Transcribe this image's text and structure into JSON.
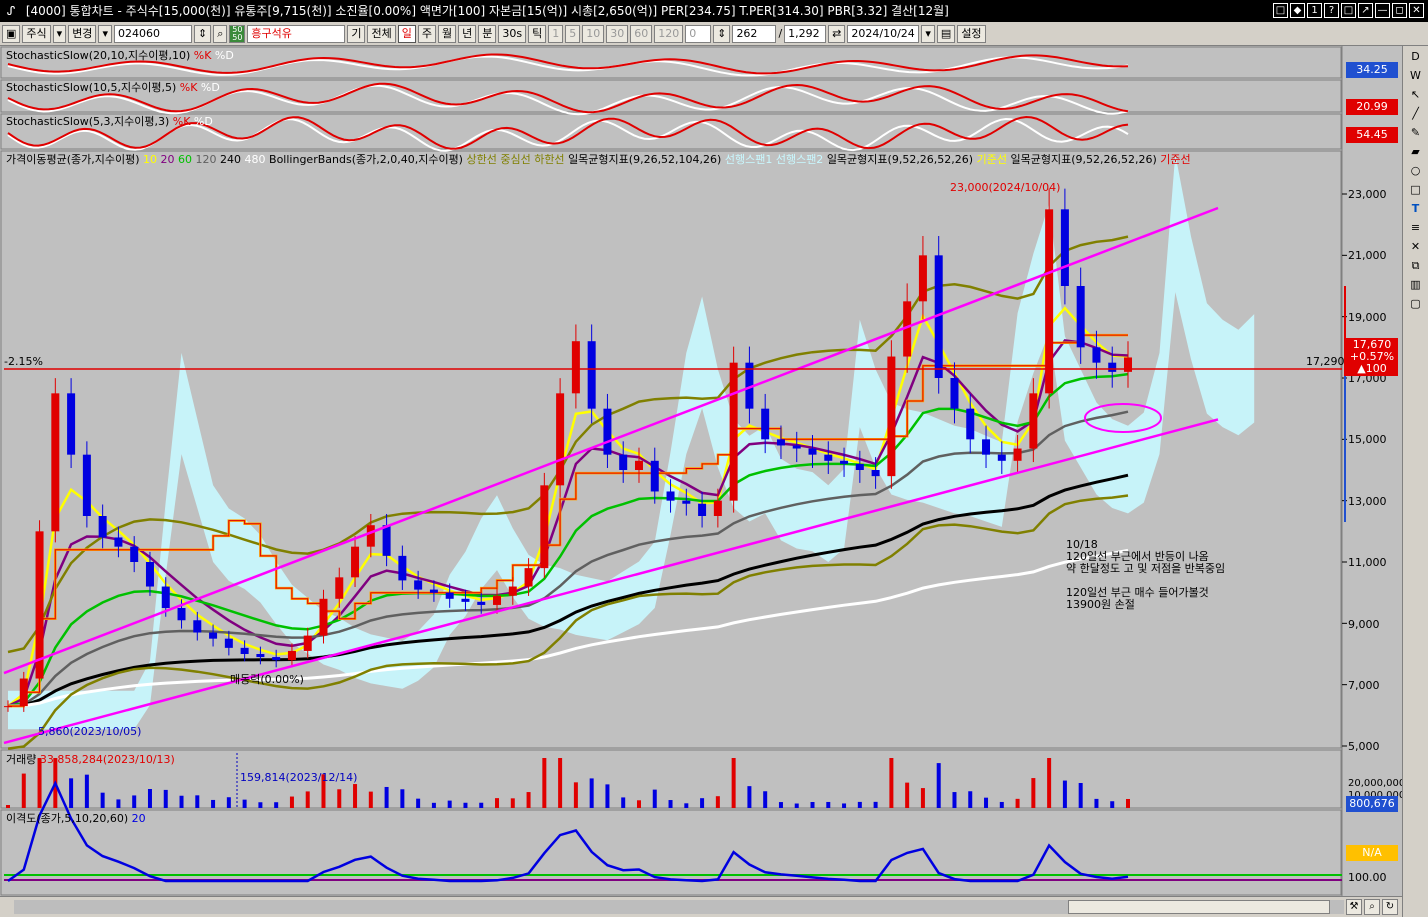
{
  "window": {
    "title": "[4000] 통합차트 - 주식수[15,000(천)] 유통주[9,715(천)] 소진율[0.00%] 액면가[100] 자본금[15(억)] 시총[2,650(억)] PER[234.75] T.PER[314.30] PBR[3.32] 결산[12월]",
    "buttons": [
      "□",
      "◆",
      "1",
      "?",
      "□",
      "↗",
      "—",
      "◻",
      "✕"
    ]
  },
  "toolbar": {
    "market": "주식",
    "change": "변경",
    "code": "024060",
    "name": "흥구석유",
    "btn_gi": "기",
    "btn_all": "전체",
    "periods": [
      "일",
      "주",
      "월",
      "년",
      "분",
      "30s",
      "틱"
    ],
    "minutes": [
      "1",
      "5",
      "10",
      "30",
      "60",
      "120"
    ],
    "spin_value": "0",
    "count": "262",
    "total": "1,292",
    "date": "2024/10/24",
    "settings": "설정",
    "green_top": "50",
    "green_bottom": "50"
  },
  "panels": {
    "stoch1": {
      "name": "StochasticSlow(20,10,지수이평,10)",
      "k": "%K",
      "d": "%D",
      "value": "34.25"
    },
    "stoch2": {
      "name": "StochasticSlow(10,5,지수이평,5)",
      "k": "%K",
      "d": "%D",
      "value": "20.99"
    },
    "stoch3": {
      "name": "StochasticSlow(5,3,지수이평,3)",
      "k": "%K",
      "d": "%D",
      "value": "54.45"
    },
    "main_legend": {
      "ma": "가격이동평균(종가,지수이평)",
      "ma_periods": [
        "10",
        "20",
        "60",
        "120",
        "240",
        "480"
      ],
      "ma_colors": [
        "#ffff00",
        "#800080",
        "#00c000",
        "#606060",
        "#000000",
        "#ffffff"
      ],
      "bb": "BollingerBands(종가,2,0,40,지수이평)",
      "bb_bands": "상한선 중심선 하한선",
      "ich1": "일목균형지표(9,26,52,104,26)",
      "ich1_span1": "선행스팬1",
      "ich1_span2": "선행스팬2",
      "ich2": "일목균형지표(9,52,26,52,26)",
      "ich2_base": "기준선",
      "ich3": "일목균형지표(9,52,26,52,26)",
      "ich3_base": "기준선"
    },
    "volume": {
      "name": "거래량",
      "max_label": "33,858,284(2023/10/13)",
      "min_label": "159,814(2023/12/14)",
      "value": "800,676"
    },
    "disparity": {
      "name": "이격도(종가,5,10,20,60)",
      "period": "20",
      "value": "N/A",
      "axis": "100.00"
    }
  },
  "price": {
    "high_label": "23,000(2024/10/04)",
    "low_label": "5,860(2023/10/05)",
    "ref_pct": "-2.15%",
    "ref_price": "17,290",
    "cur_price": "17,670",
    "cur_change": "+0.57%",
    "cur_delta": "▲100",
    "misc_label": "매동력(0.00%)",
    "annotation1": [
      "10/18",
      "120일선 부근에서 반등이 나옴",
      "약 한달정도 고 및 저점을 반복중임"
    ],
    "annotation2": [
      "120일선 부근 매수 들어가볼것",
      "13900원 손절"
    ]
  },
  "axis": {
    "price_ticks": [
      "23,000",
      "21,000",
      "19,000",
      "17,000",
      "15,000",
      "13,000",
      "11,000",
      "9,000",
      "7,000",
      "5,000"
    ],
    "volume_ticks": [
      "20,000,000",
      "10,000,000"
    ]
  },
  "colors": {
    "up": "#e00000",
    "down": "#0000e0",
    "trend": "#ff00ff",
    "ref": "#e00000",
    "cloud": "#c8f8ff"
  },
  "chart_data": {
    "type": "candlestick",
    "y_ticks": [
      5000,
      7000,
      9000,
      11000,
      13000,
      15000,
      17000,
      19000,
      21000,
      23000
    ],
    "ylim": [
      5000,
      23500
    ],
    "closes": [
      6300,
      7200,
      12000,
      16500,
      14500,
      12500,
      11800,
      11500,
      11000,
      10200,
      9500,
      9100,
      8700,
      8500,
      8200,
      8000,
      7900,
      7800,
      8100,
      8600,
      9800,
      10500,
      11500,
      12200,
      11200,
      10400,
      10100,
      10000,
      9800,
      9700,
      9600,
      9900,
      10200,
      10800,
      13500,
      16500,
      18200,
      16000,
      14500,
      14000,
      14300,
      13300,
      13000,
      12900,
      12500,
      13000,
      17500,
      16000,
      15000,
      14800,
      14700,
      14500,
      14300,
      14200,
      14000,
      13800,
      17700,
      19500,
      21000,
      17000,
      16000,
      15000,
      14500,
      14300,
      14700,
      16500,
      22500,
      20000,
      18000,
      17500,
      17200,
      17670
    ]
  }
}
